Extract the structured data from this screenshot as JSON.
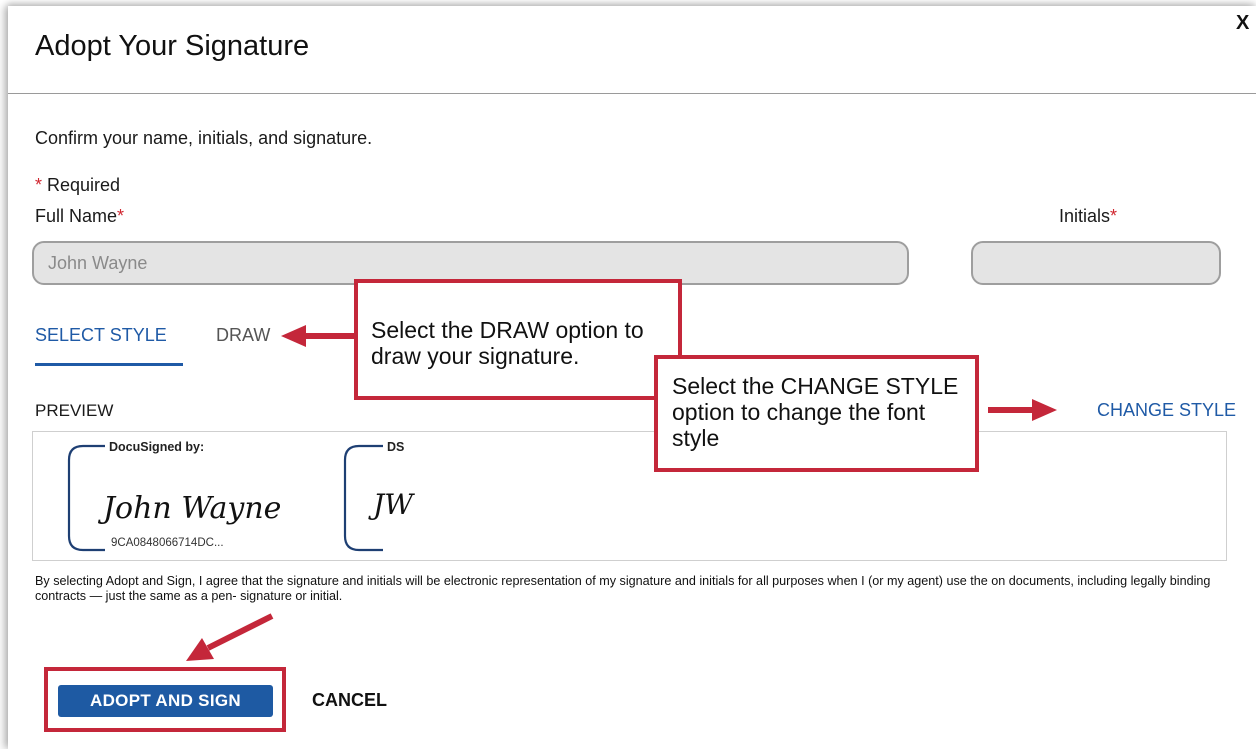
{
  "dialog": {
    "title": "Adopt Your Signature",
    "close_label": "X"
  },
  "form": {
    "instruction": "Confirm your name, initials, and signature.",
    "required_star": "*",
    "required_text": " Required",
    "full_name_label": "Full Name",
    "full_name_value": "John Wayne",
    "initials_label": "Initials",
    "initials_value": ""
  },
  "tabs": [
    {
      "label": "SELECT STYLE",
      "active": true
    },
    {
      "label": "DRAW",
      "active": false
    }
  ],
  "preview": {
    "label": "PREVIEW",
    "change_style_label": "CHANGE STYLE",
    "signature": {
      "header": "DocuSigned by:",
      "name": "John Wayne",
      "id": "9CA0848066714DC..."
    },
    "initials": {
      "header": "DS",
      "text": "JW"
    }
  },
  "legal_text": "By selecting Adopt and Sign, I agree that the signature and initials will be electronic representation of my signature and initials for all purposes when I (or my agent) use the on documents, including legally binding contracts — just the same as a pen- signature or initial.",
  "actions": {
    "adopt_label": "ADOPT AND SIGN",
    "cancel_label": "CANCEL"
  },
  "annotations": {
    "draw_callout": "Select the DRAW option to draw your signature.",
    "change_callout": "Select the CHANGE STYLE option to change the font style"
  },
  "colors": {
    "accent_blue": "#1f5aa6",
    "annotation_red": "#c4273a",
    "required_red": "#d0262f"
  }
}
